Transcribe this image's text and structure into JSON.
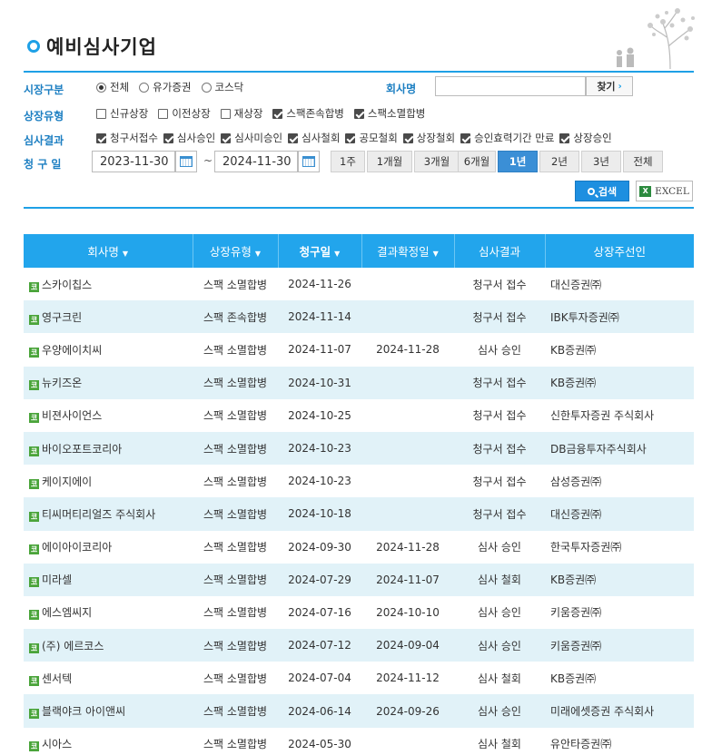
{
  "page": {
    "title": "예비심사기업"
  },
  "filters": {
    "market": {
      "label": "시장구분",
      "options": [
        {
          "label": "전체",
          "selected": true
        },
        {
          "label": "유가증권",
          "selected": false
        },
        {
          "label": "코스닥",
          "selected": false
        }
      ]
    },
    "company": {
      "label": "회사명",
      "value": "",
      "button": "찾기",
      "button_arrow": "›"
    },
    "listing_type": {
      "label": "상장유형",
      "options": [
        {
          "label": "신규상장",
          "checked": false
        },
        {
          "label": "이전상장",
          "checked": false
        },
        {
          "label": "재상장",
          "checked": false
        },
        {
          "label": "스팩존속합병",
          "checked": true
        },
        {
          "label": "스팩소멸합병",
          "checked": true
        }
      ]
    },
    "review_result": {
      "label": "심사결과",
      "options": [
        {
          "label": "청구서접수",
          "checked": true
        },
        {
          "label": "심사승인",
          "checked": true
        },
        {
          "label": "심사미승인",
          "checked": true
        },
        {
          "label": "심사철회",
          "checked": true
        },
        {
          "label": "공모철회",
          "checked": true
        },
        {
          "label": "상장철회",
          "checked": true
        },
        {
          "label": "승인효력기간 만료",
          "checked": true
        },
        {
          "label": "상장승인",
          "checked": true
        }
      ]
    },
    "claim_date": {
      "label": "청 구 일",
      "from": "2023-11-30",
      "separator": "~",
      "to": "2024-11-30",
      "periods": [
        "1주",
        "1개월",
        "3개월",
        "6개월",
        "1년",
        "2년",
        "3년",
        "전체"
      ],
      "active_period": "1년"
    },
    "search_button": "검색",
    "excel_button": "EXCEL",
    "excel_icon": "X"
  },
  "table": {
    "headers": [
      "회사명",
      "상장유형",
      "청구일",
      "결과확정일",
      "심사결과",
      "상장주선인"
    ],
    "sortable": [
      true,
      true,
      true,
      true,
      false,
      false
    ],
    "sorted_col": 2,
    "sort_arrow": "▼",
    "market_mark": "코",
    "rows": [
      [
        "스카이칩스",
        "스팩 소멸합병",
        "2024-11-26",
        "",
        "청구서 접수",
        "대신증권㈜"
      ],
      [
        "영구크린",
        "스팩 존속합병",
        "2024-11-14",
        "",
        "청구서 접수",
        "IBK투자증권㈜"
      ],
      [
        "우양에이치씨",
        "스팩 소멸합병",
        "2024-11-07",
        "2024-11-28",
        "심사 승인",
        "KB증권㈜"
      ],
      [
        "뉴키즈온",
        "스팩 소멸합병",
        "2024-10-31",
        "",
        "청구서 접수",
        "KB증권㈜"
      ],
      [
        "비젼사이언스",
        "스팩 소멸합병",
        "2024-10-25",
        "",
        "청구서 접수",
        "신한투자증권 주식회사"
      ],
      [
        "바이오포트코리아",
        "스팩 소멸합병",
        "2024-10-23",
        "",
        "청구서 접수",
        "DB금융투자주식회사"
      ],
      [
        "케이지에이",
        "스팩 소멸합병",
        "2024-10-23",
        "",
        "청구서 접수",
        "삼성증권㈜"
      ],
      [
        "티씨머티리얼즈 주식회사",
        "스팩 소멸합병",
        "2024-10-18",
        "",
        "청구서 접수",
        "대신증권㈜"
      ],
      [
        "에이아이코리아",
        "스팩 소멸합병",
        "2024-09-30",
        "2024-11-28",
        "심사 승인",
        "한국투자증권㈜"
      ],
      [
        "미라셀",
        "스팩 소멸합병",
        "2024-07-29",
        "2024-11-07",
        "심사 철회",
        "KB증권㈜"
      ],
      [
        "에스엠씨지",
        "스팩 소멸합병",
        "2024-07-16",
        "2024-10-10",
        "심사 승인",
        "키움증권㈜"
      ],
      [
        "(주) 에르코스",
        "스팩 소멸합병",
        "2024-07-12",
        "2024-09-04",
        "심사 승인",
        "키움증권㈜"
      ],
      [
        "센서텍",
        "스팩 소멸합병",
        "2024-07-04",
        "2024-11-12",
        "심사 철회",
        "KB증권㈜"
      ],
      [
        "블랙야크 아이앤씨",
        "스팩 소멸합병",
        "2024-06-14",
        "2024-09-26",
        "심사 승인",
        "미래에셋증권 주식회사"
      ],
      [
        "시아스",
        "스팩 소멸합병",
        "2024-05-30",
        "",
        "심사 철회",
        "유안타증권㈜"
      ]
    ]
  },
  "colors": {
    "accent": "#1ea0e6",
    "header_bg": "#22a5ec",
    "alt_row": "#e1f2f8",
    "label": "#1d7fc2",
    "active_period": "#3b8fd6",
    "market_mark": "#4aa43a"
  }
}
